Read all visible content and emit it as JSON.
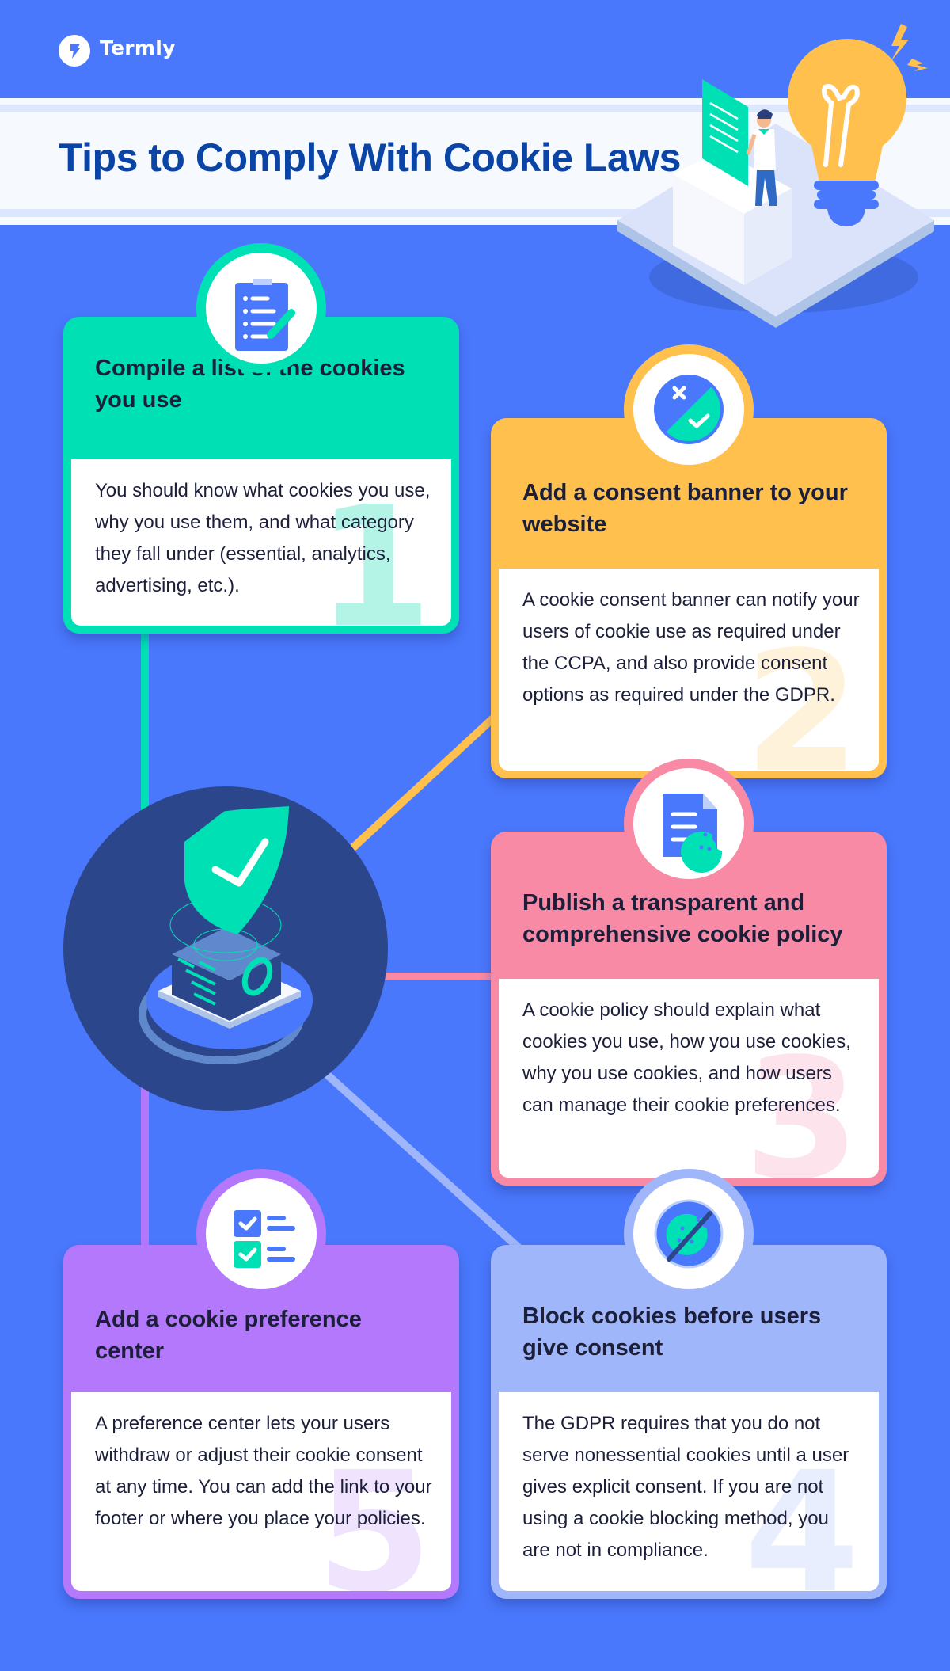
{
  "brand": {
    "name": "Termly",
    "logo_icon": "termly-bolt-icon"
  },
  "header": {
    "title": "Tips to Comply With Cookie Laws",
    "illustration": "lightbulb-ballot-box-illustration"
  },
  "center_illustration": "shield-checkmark-server-illustration",
  "colors": {
    "background": "#4a78fc",
    "title": "#0a44a6",
    "text": "#1c1f3a",
    "center_circle": "#2c468c"
  },
  "tips": [
    {
      "number": "1",
      "title": "Compile a list of the cookies you use",
      "body": "You should know what cookies you use, why you use them, and what category they fall under (essential, analytics, advertising, etc.).",
      "icon": "clipboard-list-icon",
      "color": "#00e0b5",
      "number_color": "#b4f4e6"
    },
    {
      "number": "2",
      "title": "Add a consent banner to your website",
      "body": "A cookie consent banner can notify your users of cookie use as required under the CCPA, and also provide consent options as required under the GDPR.",
      "icon": "consent-toggle-icon",
      "color": "#ffc04e",
      "number_color": "#fff2da"
    },
    {
      "number": "3",
      "title": "Publish a transparent and comprehensive cookie policy",
      "body": "A cookie policy should explain what cookies you use, how you use cookies, why you use cookies, and how users can manage their cookie preferences.",
      "icon": "document-cookie-icon",
      "color": "#f88aa6",
      "number_color": "#fde4ec"
    },
    {
      "number": "4",
      "title": "Block cookies before users give consent",
      "body": "The GDPR requires that you do not serve nonessential cookies until a user gives explicit consent. If you are not using a cookie blocking method, you are not in compliance.",
      "icon": "blocked-cookie-icon",
      "color": "#a0b6fa",
      "number_color": "#e8eefe"
    },
    {
      "number": "5",
      "title": "Add a cookie preference center",
      "body": "A preference center lets your users withdraw or adjust their cookie consent at any time. You can add the link to your footer or where you place your policies.",
      "icon": "checklist-icon",
      "color": "#b478fc",
      "number_color": "#efe3fe"
    }
  ]
}
